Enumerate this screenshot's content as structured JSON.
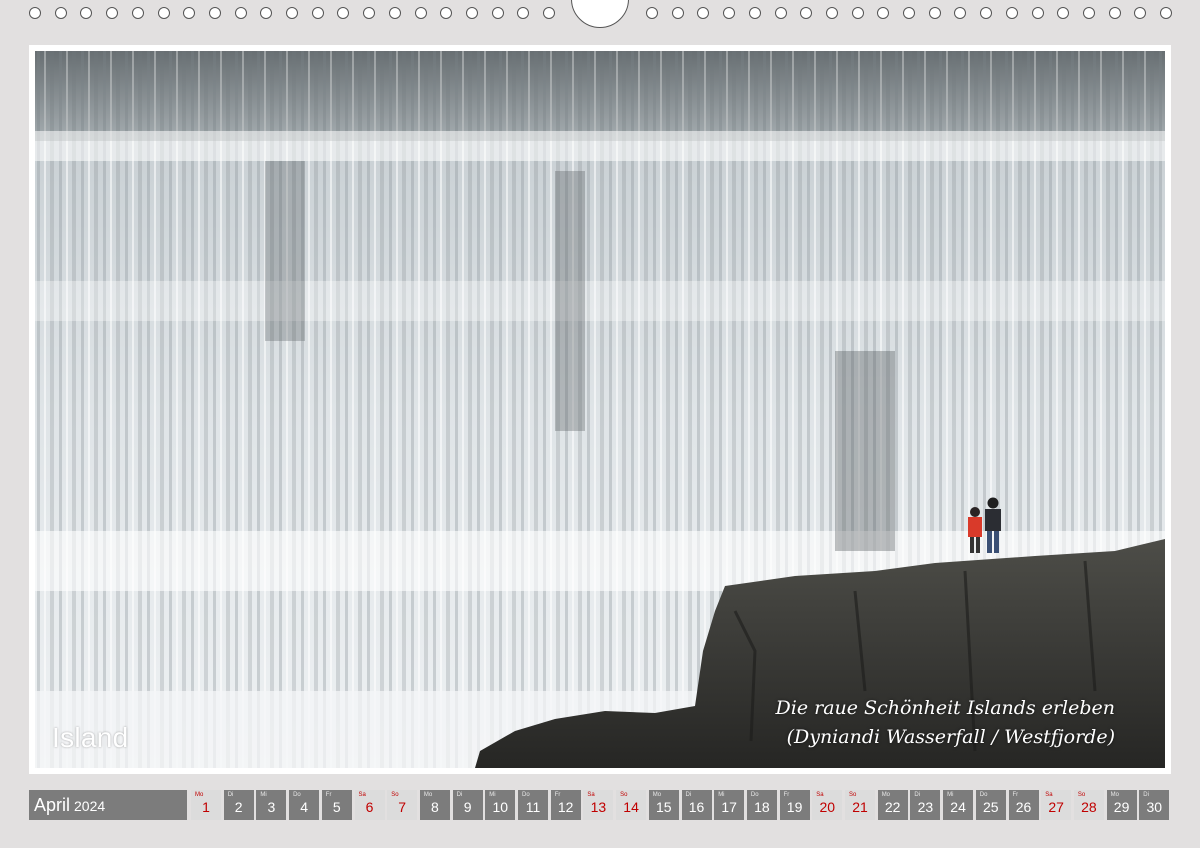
{
  "calendar": {
    "month": "April",
    "year": "2024",
    "days": [
      {
        "wd": "Mo",
        "n": "1",
        "type": "hol"
      },
      {
        "wd": "Di",
        "n": "2",
        "type": "week"
      },
      {
        "wd": "Mi",
        "n": "3",
        "type": "week"
      },
      {
        "wd": "Do",
        "n": "4",
        "type": "week"
      },
      {
        "wd": "Fr",
        "n": "5",
        "type": "week"
      },
      {
        "wd": "Sa",
        "n": "6",
        "type": "sat"
      },
      {
        "wd": "So",
        "n": "7",
        "type": "sun"
      },
      {
        "wd": "Mo",
        "n": "8",
        "type": "week"
      },
      {
        "wd": "Di",
        "n": "9",
        "type": "week"
      },
      {
        "wd": "Mi",
        "n": "10",
        "type": "week"
      },
      {
        "wd": "Do",
        "n": "11",
        "type": "week"
      },
      {
        "wd": "Fr",
        "n": "12",
        "type": "week"
      },
      {
        "wd": "Sa",
        "n": "13",
        "type": "sat"
      },
      {
        "wd": "So",
        "n": "14",
        "type": "sun"
      },
      {
        "wd": "Mo",
        "n": "15",
        "type": "week"
      },
      {
        "wd": "Di",
        "n": "16",
        "type": "week"
      },
      {
        "wd": "Mi",
        "n": "17",
        "type": "week"
      },
      {
        "wd": "Do",
        "n": "18",
        "type": "week"
      },
      {
        "wd": "Fr",
        "n": "19",
        "type": "week"
      },
      {
        "wd": "Sa",
        "n": "20",
        "type": "sat"
      },
      {
        "wd": "So",
        "n": "21",
        "type": "sun"
      },
      {
        "wd": "Mo",
        "n": "22",
        "type": "week"
      },
      {
        "wd": "Di",
        "n": "23",
        "type": "week"
      },
      {
        "wd": "Mi",
        "n": "24",
        "type": "week"
      },
      {
        "wd": "Do",
        "n": "25",
        "type": "week"
      },
      {
        "wd": "Fr",
        "n": "26",
        "type": "week"
      },
      {
        "wd": "Sa",
        "n": "27",
        "type": "sat"
      },
      {
        "wd": "So",
        "n": "28",
        "type": "sun"
      },
      {
        "wd": "Mo",
        "n": "29",
        "type": "week"
      },
      {
        "wd": "Di",
        "n": "30",
        "type": "week"
      }
    ]
  },
  "photo": {
    "title": "Island",
    "caption_line1": "Die raue Schönheit Islands erleben",
    "caption_line2": "(Dyniandi Wasserfall / Westfjorde)"
  },
  "colors": {
    "background": "#e2e0e0",
    "day_cell": "#7c7c7c",
    "weekend_text": "#c00000"
  }
}
